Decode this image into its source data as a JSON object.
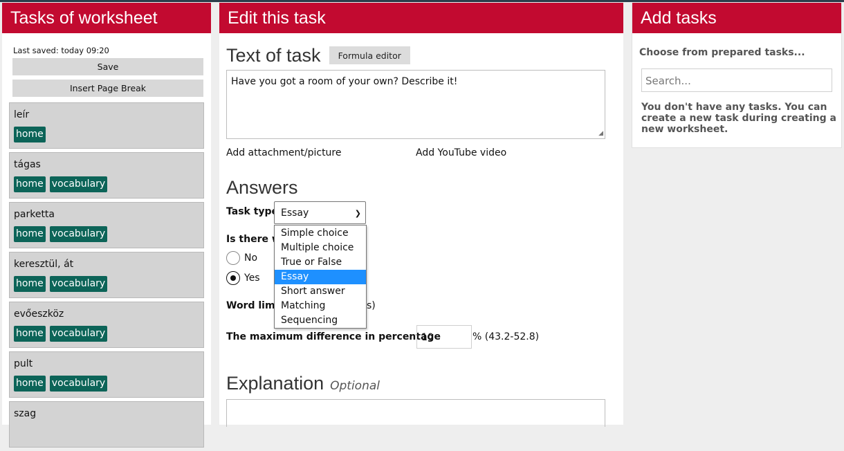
{
  "left": {
    "title": "Tasks of worksheet",
    "last_saved": "Last saved: today 09:20",
    "save_label": "Save",
    "insert_break_label": "Insert Page Break",
    "tasks": [
      {
        "name": "leír",
        "tags": [
          "home"
        ]
      },
      {
        "name": "tágas",
        "tags": [
          "home",
          "vocabulary"
        ]
      },
      {
        "name": "parketta",
        "tags": [
          "home",
          "vocabulary"
        ]
      },
      {
        "name": "keresztül, át",
        "tags": [
          "home",
          "vocabulary"
        ]
      },
      {
        "name": "evőeszköz",
        "tags": [
          "home",
          "vocabulary"
        ]
      },
      {
        "name": "pult",
        "tags": [
          "home",
          "vocabulary"
        ]
      },
      {
        "name": "szag",
        "tags": []
      }
    ]
  },
  "middle": {
    "title": "Edit this task",
    "text_of_task": "Text of task",
    "formula_editor": "Formula editor",
    "task_text": "Have you got a room of your own? Describe it!",
    "add_attachment": "Add attachment/picture",
    "add_youtube": "Add YouTube video",
    "answers": "Answers",
    "task_type_label": "Task type",
    "task_type_value": "Essay",
    "task_type_options": [
      "Simple choice",
      "Multiple choice",
      "True or False",
      "Essay",
      "Short answer",
      "Matching",
      "Sequencing"
    ],
    "wordcount_label": "Is there wo",
    "radio_no": "No",
    "radio_yes": "Yes",
    "word_limit_label": "Word limi",
    "word_limit_suffix": "s)",
    "max_diff_label": "The maximum difference in percentage",
    "max_diff_value": "10",
    "pct_range": "% (43.2-52.8)",
    "explanation": "Explanation",
    "optional": "Optional"
  },
  "right": {
    "title": "Add tasks",
    "choose_prepared": "Choose from prepared tasks...",
    "search_placeholder": "Search...",
    "no_tasks_msg": "You don't have any tasks. You can create a new task during creating a new worksheet."
  },
  "colors": {
    "header_red": "#c20a30",
    "tag_teal": "#0c6458",
    "selected_blue": "#1e90ff"
  }
}
